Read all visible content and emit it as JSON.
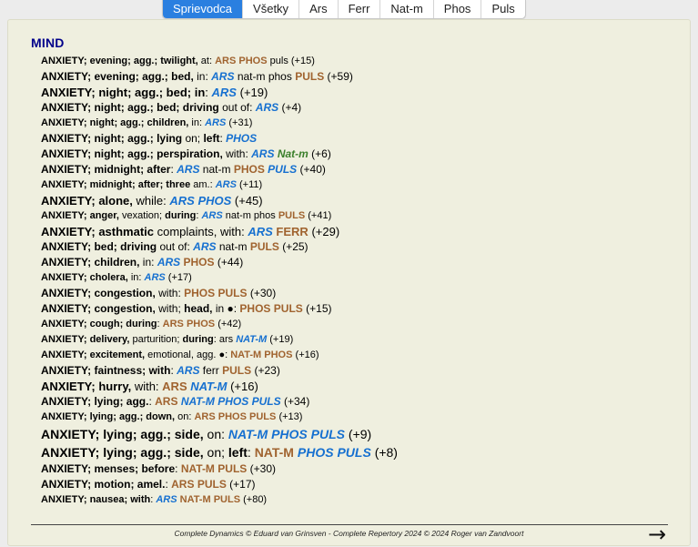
{
  "tabs": [
    {
      "label": "Sprievodca",
      "active": true
    },
    {
      "label": "Všetky",
      "active": false
    },
    {
      "label": "Ars",
      "active": false
    },
    {
      "label": "Ferr",
      "active": false
    },
    {
      "label": "Nat-m",
      "active": false
    },
    {
      "label": "Phos",
      "active": false
    },
    {
      "label": "Puls",
      "active": false
    }
  ],
  "colors": {
    "grade3": "#a0632f",
    "grade2": "#1670d0",
    "grade2_alt": "#3a7f2a",
    "grade1": "#000000",
    "heading": "#00008a",
    "active_tab": "#2a7fe0"
  },
  "chapter": "MIND",
  "rubrics": [
    {
      "size": 1,
      "parts": [
        {
          "t": "ANXIETY; evening; agg.; twilight,",
          "b": 1
        },
        {
          "t": " at: "
        }
      ],
      "rem": [
        {
          "t": "ARS",
          "g": 3
        },
        {
          "t": " "
        },
        {
          "t": "PHOS",
          "g": 3
        },
        {
          "t": " puls",
          "g": 1
        }
      ],
      "count": "(+15)"
    },
    {
      "size": 2,
      "parts": [
        {
          "t": "ANXIETY; evening; agg.; bed,",
          "b": 1
        },
        {
          "t": " in: "
        }
      ],
      "rem": [
        {
          "t": "ARS",
          "g": 2
        },
        {
          "t": " nat-m phos ",
          "g": 1
        },
        {
          "t": "PULS",
          "g": 3
        }
      ],
      "count": "(+59)"
    },
    {
      "size": 3,
      "parts": [
        {
          "t": "ANXIETY; night; agg.; bed; in",
          "b": 1
        },
        {
          "t": ": "
        }
      ],
      "rem": [
        {
          "t": "ARS",
          "g": 2
        }
      ],
      "count": "(+19)"
    },
    {
      "size": 2,
      "parts": [
        {
          "t": "ANXIETY; night; agg.; bed; driving",
          "b": 1
        },
        {
          "t": " out of: "
        }
      ],
      "rem": [
        {
          "t": "ARS",
          "g": 2
        }
      ],
      "count": "(+4)"
    },
    {
      "size": 1,
      "parts": [
        {
          "t": "ANXIETY; night; agg.; children,",
          "b": 1
        },
        {
          "t": " in: "
        }
      ],
      "rem": [
        {
          "t": "ARS",
          "g": 2
        }
      ],
      "count": "(+31)"
    },
    {
      "size": 2,
      "parts": [
        {
          "t": "ANXIETY; night; agg.; lying",
          "b": 1
        },
        {
          "t": " on; "
        },
        {
          "t": "left",
          "b": 1
        },
        {
          "t": ": "
        }
      ],
      "rem": [
        {
          "t": "PHOS",
          "g": 2
        }
      ],
      "count": ""
    },
    {
      "size": 2,
      "parts": [
        {
          "t": "ANXIETY; night; agg.; perspiration,",
          "b": 1
        },
        {
          "t": " with: "
        }
      ],
      "rem": [
        {
          "t": "ARS",
          "g": 2
        },
        {
          "t": " "
        },
        {
          "t": "Nat-m",
          "g": 4
        }
      ],
      "count": "(+6)"
    },
    {
      "size": 2,
      "parts": [
        {
          "t": "ANXIETY; midnight; after",
          "b": 1
        },
        {
          "t": ": "
        }
      ],
      "rem": [
        {
          "t": "ARS",
          "g": 2
        },
        {
          "t": " nat-m ",
          "g": 1
        },
        {
          "t": "PHOS",
          "g": 3
        },
        {
          "t": " "
        },
        {
          "t": "PULS",
          "g": 2
        }
      ],
      "count": "(+40)"
    },
    {
      "size": 1,
      "parts": [
        {
          "t": "ANXIETY; midnight; after; three",
          "b": 1
        },
        {
          "t": " am.: "
        }
      ],
      "rem": [
        {
          "t": "ARS",
          "g": 2
        }
      ],
      "count": "(+11)"
    },
    {
      "size": 3,
      "parts": [
        {
          "t": "ANXIETY; alone,",
          "b": 1
        },
        {
          "t": " while: "
        }
      ],
      "rem": [
        {
          "t": "ARS",
          "g": 2
        },
        {
          "t": " "
        },
        {
          "t": "PHOS",
          "g": 2
        }
      ],
      "count": "(+45)"
    },
    {
      "size": 1,
      "parts": [
        {
          "t": "ANXIETY; anger,",
          "b": 1
        },
        {
          "t": " vexation; "
        },
        {
          "t": "during",
          "b": 1
        },
        {
          "t": ": "
        }
      ],
      "rem": [
        {
          "t": "ARS",
          "g": 2
        },
        {
          "t": " nat-m phos ",
          "g": 1
        },
        {
          "t": "PULS",
          "g": 3
        }
      ],
      "count": "(+41)"
    },
    {
      "size": 3,
      "parts": [
        {
          "t": "ANXIETY; asthmatic",
          "b": 1
        },
        {
          "t": " complaints, with: "
        }
      ],
      "rem": [
        {
          "t": "ARS",
          "g": 2
        },
        {
          "t": " "
        },
        {
          "t": "FERR",
          "g": 3
        }
      ],
      "count": "(+29)"
    },
    {
      "size": 2,
      "parts": [
        {
          "t": "ANXIETY; bed; driving",
          "b": 1
        },
        {
          "t": " out of: "
        }
      ],
      "rem": [
        {
          "t": "ARS",
          "g": 2
        },
        {
          "t": " nat-m ",
          "g": 1
        },
        {
          "t": "PULS",
          "g": 3
        }
      ],
      "count": "(+25)"
    },
    {
      "size": 2,
      "parts": [
        {
          "t": "ANXIETY; children,",
          "b": 1
        },
        {
          "t": " in: "
        }
      ],
      "rem": [
        {
          "t": "ARS",
          "g": 2
        },
        {
          "t": " "
        },
        {
          "t": "PHOS",
          "g": 3
        }
      ],
      "count": "(+44)"
    },
    {
      "size": 1,
      "parts": [
        {
          "t": "ANXIETY; cholera,",
          "b": 1
        },
        {
          "t": " in: "
        }
      ],
      "rem": [
        {
          "t": "ARS",
          "g": 2
        }
      ],
      "count": "(+17)"
    },
    {
      "size": 2,
      "parts": [
        {
          "t": "ANXIETY; congestion,",
          "b": 1
        },
        {
          "t": " with: "
        }
      ],
      "rem": [
        {
          "t": "PHOS",
          "g": 3
        },
        {
          "t": " "
        },
        {
          "t": "PULS",
          "g": 3
        }
      ],
      "count": "(+30)"
    },
    {
      "size": 2,
      "parts": [
        {
          "t": "ANXIETY; congestion,",
          "b": 1
        },
        {
          "t": " with; "
        },
        {
          "t": "head,",
          "b": 1
        },
        {
          "t": " in ●: "
        }
      ],
      "rem": [
        {
          "t": "PHOS",
          "g": 3
        },
        {
          "t": " "
        },
        {
          "t": "PULS",
          "g": 3
        }
      ],
      "count": "(+15)"
    },
    {
      "size": 1,
      "parts": [
        {
          "t": "ANXIETY; cough; during",
          "b": 1
        },
        {
          "t": ": "
        }
      ],
      "rem": [
        {
          "t": "ARS",
          "g": 3
        },
        {
          "t": " "
        },
        {
          "t": "PHOS",
          "g": 3
        }
      ],
      "count": "(+42)"
    },
    {
      "size": 1,
      "parts": [
        {
          "t": "ANXIETY; delivery,",
          "b": 1
        },
        {
          "t": " parturition; "
        },
        {
          "t": "during",
          "b": 1
        },
        {
          "t": ": "
        }
      ],
      "rem": [
        {
          "t": "ars ",
          "g": 1
        },
        {
          "t": "NAT-M",
          "g": 2
        }
      ],
      "count": "(+19)"
    },
    {
      "size": 1,
      "parts": [
        {
          "t": "ANXIETY; excitement,",
          "b": 1
        },
        {
          "t": " emotional, agg. ●: "
        }
      ],
      "rem": [
        {
          "t": "NAT-M",
          "g": 3
        },
        {
          "t": " "
        },
        {
          "t": "PHOS",
          "g": 3
        }
      ],
      "count": "(+16)"
    },
    {
      "size": 2,
      "parts": [
        {
          "t": "ANXIETY; faintness; with",
          "b": 1
        },
        {
          "t": ": "
        }
      ],
      "rem": [
        {
          "t": "ARS",
          "g": 2
        },
        {
          "t": " ferr ",
          "g": 1
        },
        {
          "t": "PULS",
          "g": 3
        }
      ],
      "count": "(+23)"
    },
    {
      "size": 3,
      "parts": [
        {
          "t": "ANXIETY; hurry,",
          "b": 1
        },
        {
          "t": " with: "
        }
      ],
      "rem": [
        {
          "t": "ARS",
          "g": 3
        },
        {
          "t": " "
        },
        {
          "t": "NAT-M",
          "g": 2
        }
      ],
      "count": "(+16)"
    },
    {
      "size": 2,
      "parts": [
        {
          "t": "ANXIETY; lying; agg.",
          "b": 1
        },
        {
          "t": ": "
        }
      ],
      "rem": [
        {
          "t": "ARS",
          "g": 3
        },
        {
          "t": " "
        },
        {
          "t": "NAT-M",
          "g": 2
        },
        {
          "t": " "
        },
        {
          "t": "PHOS",
          "g": 2
        },
        {
          "t": " "
        },
        {
          "t": "PULS",
          "g": 2
        }
      ],
      "count": "(+34)"
    },
    {
      "size": 1,
      "parts": [
        {
          "t": "ANXIETY; lying; agg.; down,",
          "b": 1
        },
        {
          "t": " on: "
        }
      ],
      "rem": [
        {
          "t": "ARS",
          "g": 3
        },
        {
          "t": " "
        },
        {
          "t": "PHOS",
          "g": 3
        },
        {
          "t": " "
        },
        {
          "t": "PULS",
          "g": 3
        }
      ],
      "count": "(+13)"
    },
    {
      "size": 4,
      "parts": [
        {
          "t": "ANXIETY; lying; agg.; side,",
          "b": 1
        },
        {
          "t": " on: "
        }
      ],
      "rem": [
        {
          "t": "NAT-M",
          "g": 2
        },
        {
          "t": " "
        },
        {
          "t": "PHOS",
          "g": 2
        },
        {
          "t": " "
        },
        {
          "t": "PULS",
          "g": 2
        }
      ],
      "count": "(+9)"
    },
    {
      "size": 4,
      "parts": [
        {
          "t": "ANXIETY; lying; agg.; side,",
          "b": 1
        },
        {
          "t": " on; "
        },
        {
          "t": "left",
          "b": 1
        },
        {
          "t": ": "
        }
      ],
      "rem": [
        {
          "t": "NAT-M",
          "g": 3
        },
        {
          "t": " "
        },
        {
          "t": "PHOS",
          "g": 2
        },
        {
          "t": " "
        },
        {
          "t": "PULS",
          "g": 2
        }
      ],
      "count": "(+8)"
    },
    {
      "size": 2,
      "parts": [
        {
          "t": "ANXIETY; menses; before",
          "b": 1
        },
        {
          "t": ": "
        }
      ],
      "rem": [
        {
          "t": "NAT-M",
          "g": 3
        },
        {
          "t": " "
        },
        {
          "t": "PULS",
          "g": 3
        }
      ],
      "count": "(+30)"
    },
    {
      "size": 2,
      "parts": [
        {
          "t": "ANXIETY; motion; amel.",
          "b": 1
        },
        {
          "t": ": "
        }
      ],
      "rem": [
        {
          "t": "ARS",
          "g": 3
        },
        {
          "t": " "
        },
        {
          "t": "PULS",
          "g": 3
        }
      ],
      "count": "(+17)"
    },
    {
      "size": 1,
      "parts": [
        {
          "t": "ANXIETY; nausea; with",
          "b": 1
        },
        {
          "t": ": "
        }
      ],
      "rem": [
        {
          "t": "ARS",
          "g": 2
        },
        {
          "t": " "
        },
        {
          "t": "NAT-M",
          "g": 3
        },
        {
          "t": " "
        },
        {
          "t": "PULS",
          "g": 3
        }
      ],
      "count": "(+80)"
    }
  ],
  "footer": "Complete Dynamics © Eduard van Grinsven   -   Complete Repertory 2024 © 2024 Roger van Zandvoort",
  "next_arrow": "🡒",
  "next_icon": "right-arrow-icon"
}
